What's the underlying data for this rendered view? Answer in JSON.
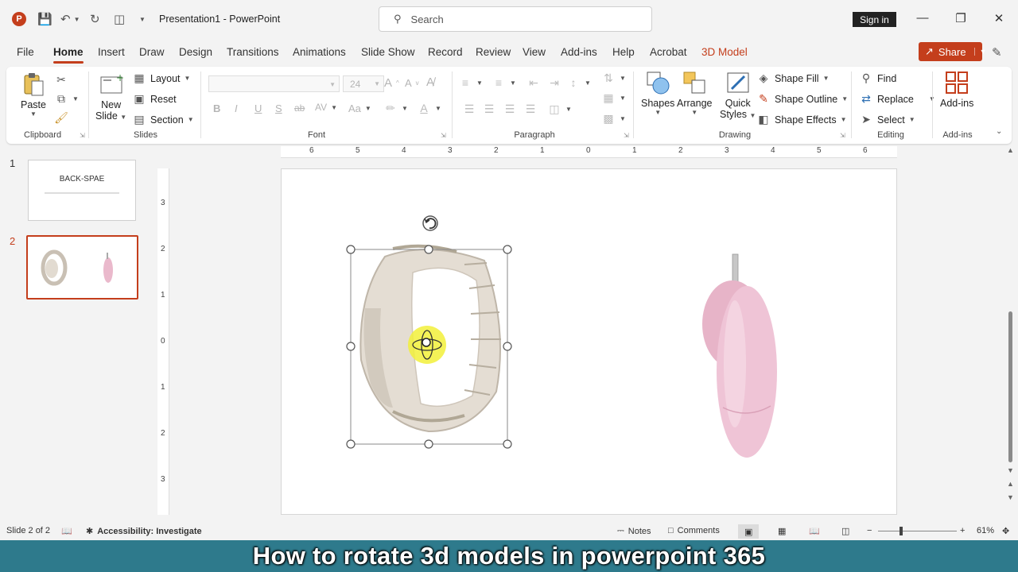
{
  "window": {
    "doc_title": "Presentation1  -  PowerPoint",
    "search_placeholder": "Search",
    "sign_in": "Sign in"
  },
  "tabs": [
    "File",
    "Home",
    "Insert",
    "Draw",
    "Design",
    "Transitions",
    "Animations",
    "Slide Show",
    "Record",
    "Review",
    "View",
    "Add-ins",
    "Help",
    "Acrobat",
    "3D Model"
  ],
  "active_tab": "Home",
  "share_label": "Share",
  "ribbon": {
    "clipboard": {
      "paste": "Paste",
      "label": "Clipboard"
    },
    "slides": {
      "new_slide": "New",
      "new_slide_2": "Slide",
      "layout": "Layout",
      "reset": "Reset",
      "section": "Section",
      "label": "Slides"
    },
    "font": {
      "size": "24",
      "bold": "B",
      "italic": "I",
      "underline": "U",
      "strike": "S",
      "shadow": "ab",
      "label": "Font",
      "aa": "Aa",
      "grow": "A",
      "shrink": "A"
    },
    "paragraph": {
      "label": "Paragraph"
    },
    "drawing": {
      "shapes": "Shapes",
      "arrange": "Arrange",
      "quick_styles_1": "Quick",
      "quick_styles_2": "Styles",
      "shape_fill": "Shape Fill",
      "shape_outline": "Shape Outline",
      "shape_effects": "Shape Effects",
      "label": "Drawing"
    },
    "editing": {
      "find": "Find",
      "replace": "Replace",
      "select": "Select",
      "label": "Editing"
    },
    "addins": {
      "addins_btn": "Add-ins",
      "label": "Add-ins"
    }
  },
  "ruler_h": [
    "6",
    "5",
    "4",
    "3",
    "2",
    "1",
    "0",
    "1",
    "2",
    "3",
    "4",
    "5",
    "6"
  ],
  "ruler_v": [
    "3",
    "2",
    "1",
    "0",
    "1",
    "2",
    "3"
  ],
  "slides": [
    {
      "number": "1",
      "title": "BACK-SPAE"
    },
    {
      "number": "2"
    }
  ],
  "status": {
    "slide_count": "Slide 2 of 2",
    "accessibility": "Accessibility: Investigate",
    "notes": "Notes",
    "comments": "Comments",
    "zoom": "61%"
  },
  "caption": "How to rotate 3d models in powerpoint 365",
  "colors": {
    "accent": "#c43e1c",
    "banner": "#2e7a8c",
    "watch": "#d9d2c9",
    "bean": "#eab9cc"
  }
}
